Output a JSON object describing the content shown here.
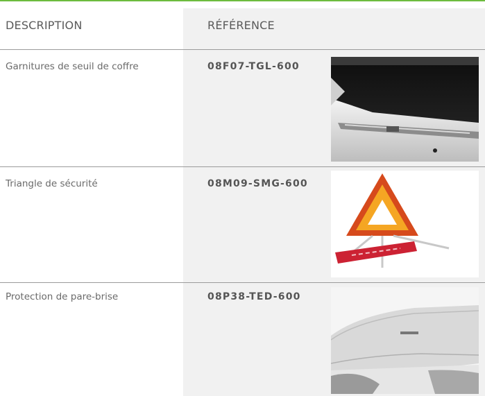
{
  "table": {
    "header": {
      "description": "DESCRIPTION",
      "reference": "RÉFÉRENCE"
    },
    "rows": [
      {
        "description": "Garnitures de seuil de coffre",
        "reference": "08F07-TGL-600",
        "image": "trunk-sill-garnish-photo"
      },
      {
        "description": "Triangle de sécurité",
        "reference": "08M09-SMG-600",
        "image": "warning-triangle-photo"
      },
      {
        "description": "Protection de pare-brise",
        "reference": "08P38-TED-600",
        "image": "windshield-cover-photo"
      }
    ]
  },
  "colors": {
    "accent_line": "#6dbb3e",
    "reference_column_bg": "#f1f1f1",
    "divider": "#9a9a9a"
  }
}
